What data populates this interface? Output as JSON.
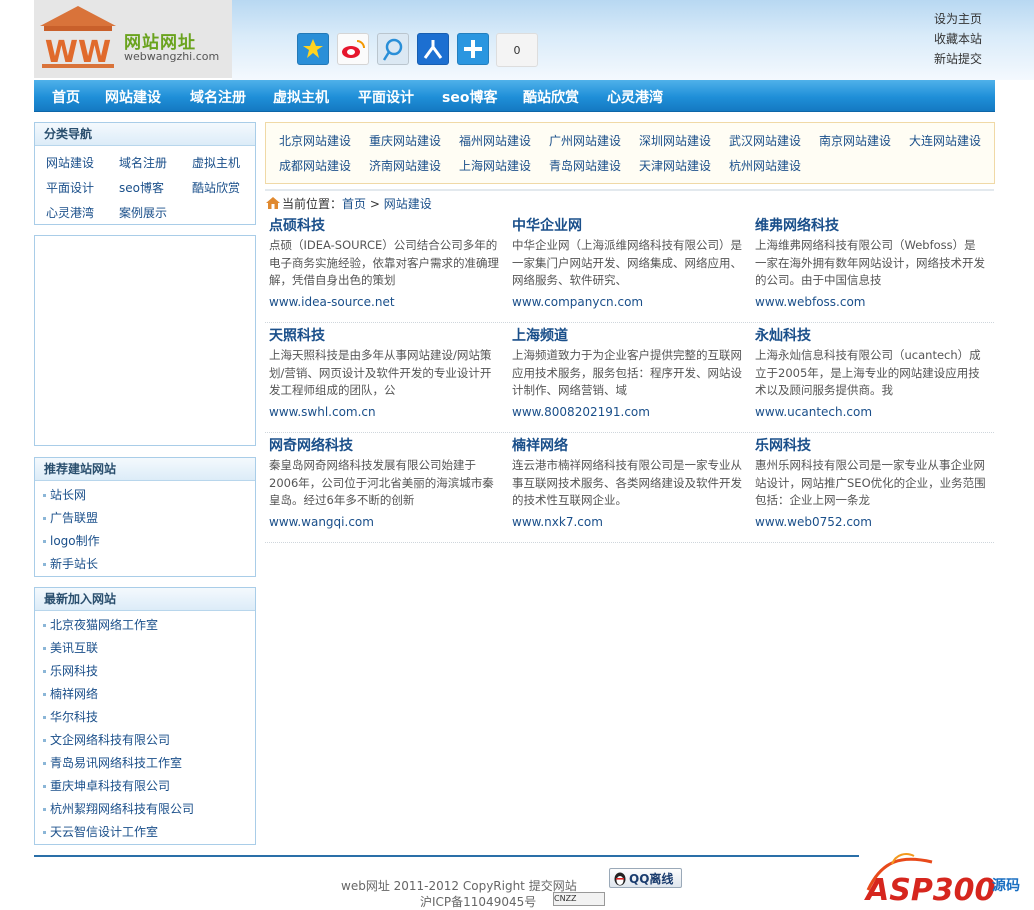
{
  "header": {
    "logo_cn": "网站网址",
    "logo_en": "webwangzhi.com",
    "share_count": "0",
    "share_icons": [
      "qzone-icon",
      "weibo-icon",
      "tencent-weibo-icon",
      "renren-icon",
      "more-share-icon"
    ],
    "top_links": [
      "设为主页",
      "收藏本站",
      "新站提交"
    ]
  },
  "nav": [
    "首页",
    "网站建设",
    "域名注册",
    "虚拟主机",
    "平面设计",
    "seo博客",
    "酷站欣赏",
    "心灵港湾"
  ],
  "sidebar": {
    "category_title": "分类导航",
    "categories": [
      "网站建设",
      "域名注册",
      "虚拟主机",
      "平面设计",
      "seo博客",
      "酷站欣赏",
      "心灵港湾",
      "案例展示"
    ],
    "recommend_title": "推荐建站网站",
    "recommend": [
      "站长网",
      "广告联盟",
      "logo制作",
      "新手站长"
    ],
    "latest_title": "最新加入网站",
    "latest": [
      "北京夜猫网络工作室",
      "美讯互联",
      "乐网科技",
      "楠祥网络",
      "华尔科技",
      "文企网络科技有限公司",
      "青岛易讯网络科技工作室",
      "重庆坤卓科技有限公司",
      "杭州絜翔网络科技有限公司",
      "天云智信设计工作室"
    ]
  },
  "cities": [
    "北京网站建设",
    "重庆网站建设",
    "福州网站建设",
    "广州网站建设",
    "深圳网站建设",
    "武汉网站建设",
    "南京网站建设",
    "大连网站建设",
    "成都网站建设",
    "济南网站建设",
    "上海网站建设",
    "青岛网站建设",
    "天津网站建设",
    "杭州网站建设"
  ],
  "breadcrumb": {
    "label": "当前位置：",
    "home": "首页",
    "sep": ">",
    "current": "网站建设"
  },
  "sites": [
    {
      "name": "点硕科技",
      "desc": "点硕（IDEA-SOURCE）公司结合公司多年的电子商务实施经验，依靠对客户需求的准确理解，凭借自身出色的策划",
      "url": "www.idea-source.net"
    },
    {
      "name": "中华企业网",
      "desc": "中华企业网（上海派维网络科技有限公司）是一家集门户网站开发、网络集成、网络应用、网络服务、软件研究、",
      "url": "www.companycn.com"
    },
    {
      "name": "维弗网络科技",
      "desc": "上海维弗网络科技有限公司（Webfoss）是一家在海外拥有数年网站设计，网络技术开发的公司。由于中国信息技",
      "url": "www.webfoss.com"
    },
    {
      "name": "天照科技",
      "desc": "上海天照科技是由多年从事网站建设/网站策划/营销、网页设计及软件开发的专业设计开发工程师组成的团队，公",
      "url": "www.swhl.com.cn"
    },
    {
      "name": "上海频道",
      "desc": "上海频道致力于为企业客户提供完整的互联网应用技术服务，服务包括：程序开发、网站设计制作、网络营销、域",
      "url": "www.8008202191.com"
    },
    {
      "name": "永灿科技",
      "desc": "上海永灿信息科技有限公司（ucantech）成立于2005年，是上海专业的网站建设应用技术以及顾问服务提供商。我",
      "url": "www.ucantech.com"
    },
    {
      "name": "网奇网络科技",
      "desc": "秦皇岛网奇网络科技发展有限公司始建于2006年，公司位于河北省美丽的海滨城市秦皇岛。经过6年多不断的创新",
      "url": "www.wangqi.com"
    },
    {
      "name": "楠祥网络",
      "desc": "连云港市楠祥网络科技有限公司是一家专业从事互联网技术服务、各类网络建设及软件开发的技术性互联网企业。",
      "url": "www.nxk7.com"
    },
    {
      "name": "乐网科技",
      "desc": "惠州乐网科技有限公司是一家专业从事企业网站设计，网站推广SEO优化的企业，业务范围包括：企业上网一条龙",
      "url": "www.web0752.com"
    }
  ],
  "footer": {
    "line1": "web网址  2011-2012 CopyRight   提交网站",
    "icp": "沪ICP备11049045号",
    "qq_label": "QQ离线",
    "cnzz": "CNZZ",
    "watermark": "ASP300源码"
  },
  "colors": {
    "nav": "#1f8fd8",
    "link": "#1a4f8a",
    "border": "#a9cde8"
  }
}
